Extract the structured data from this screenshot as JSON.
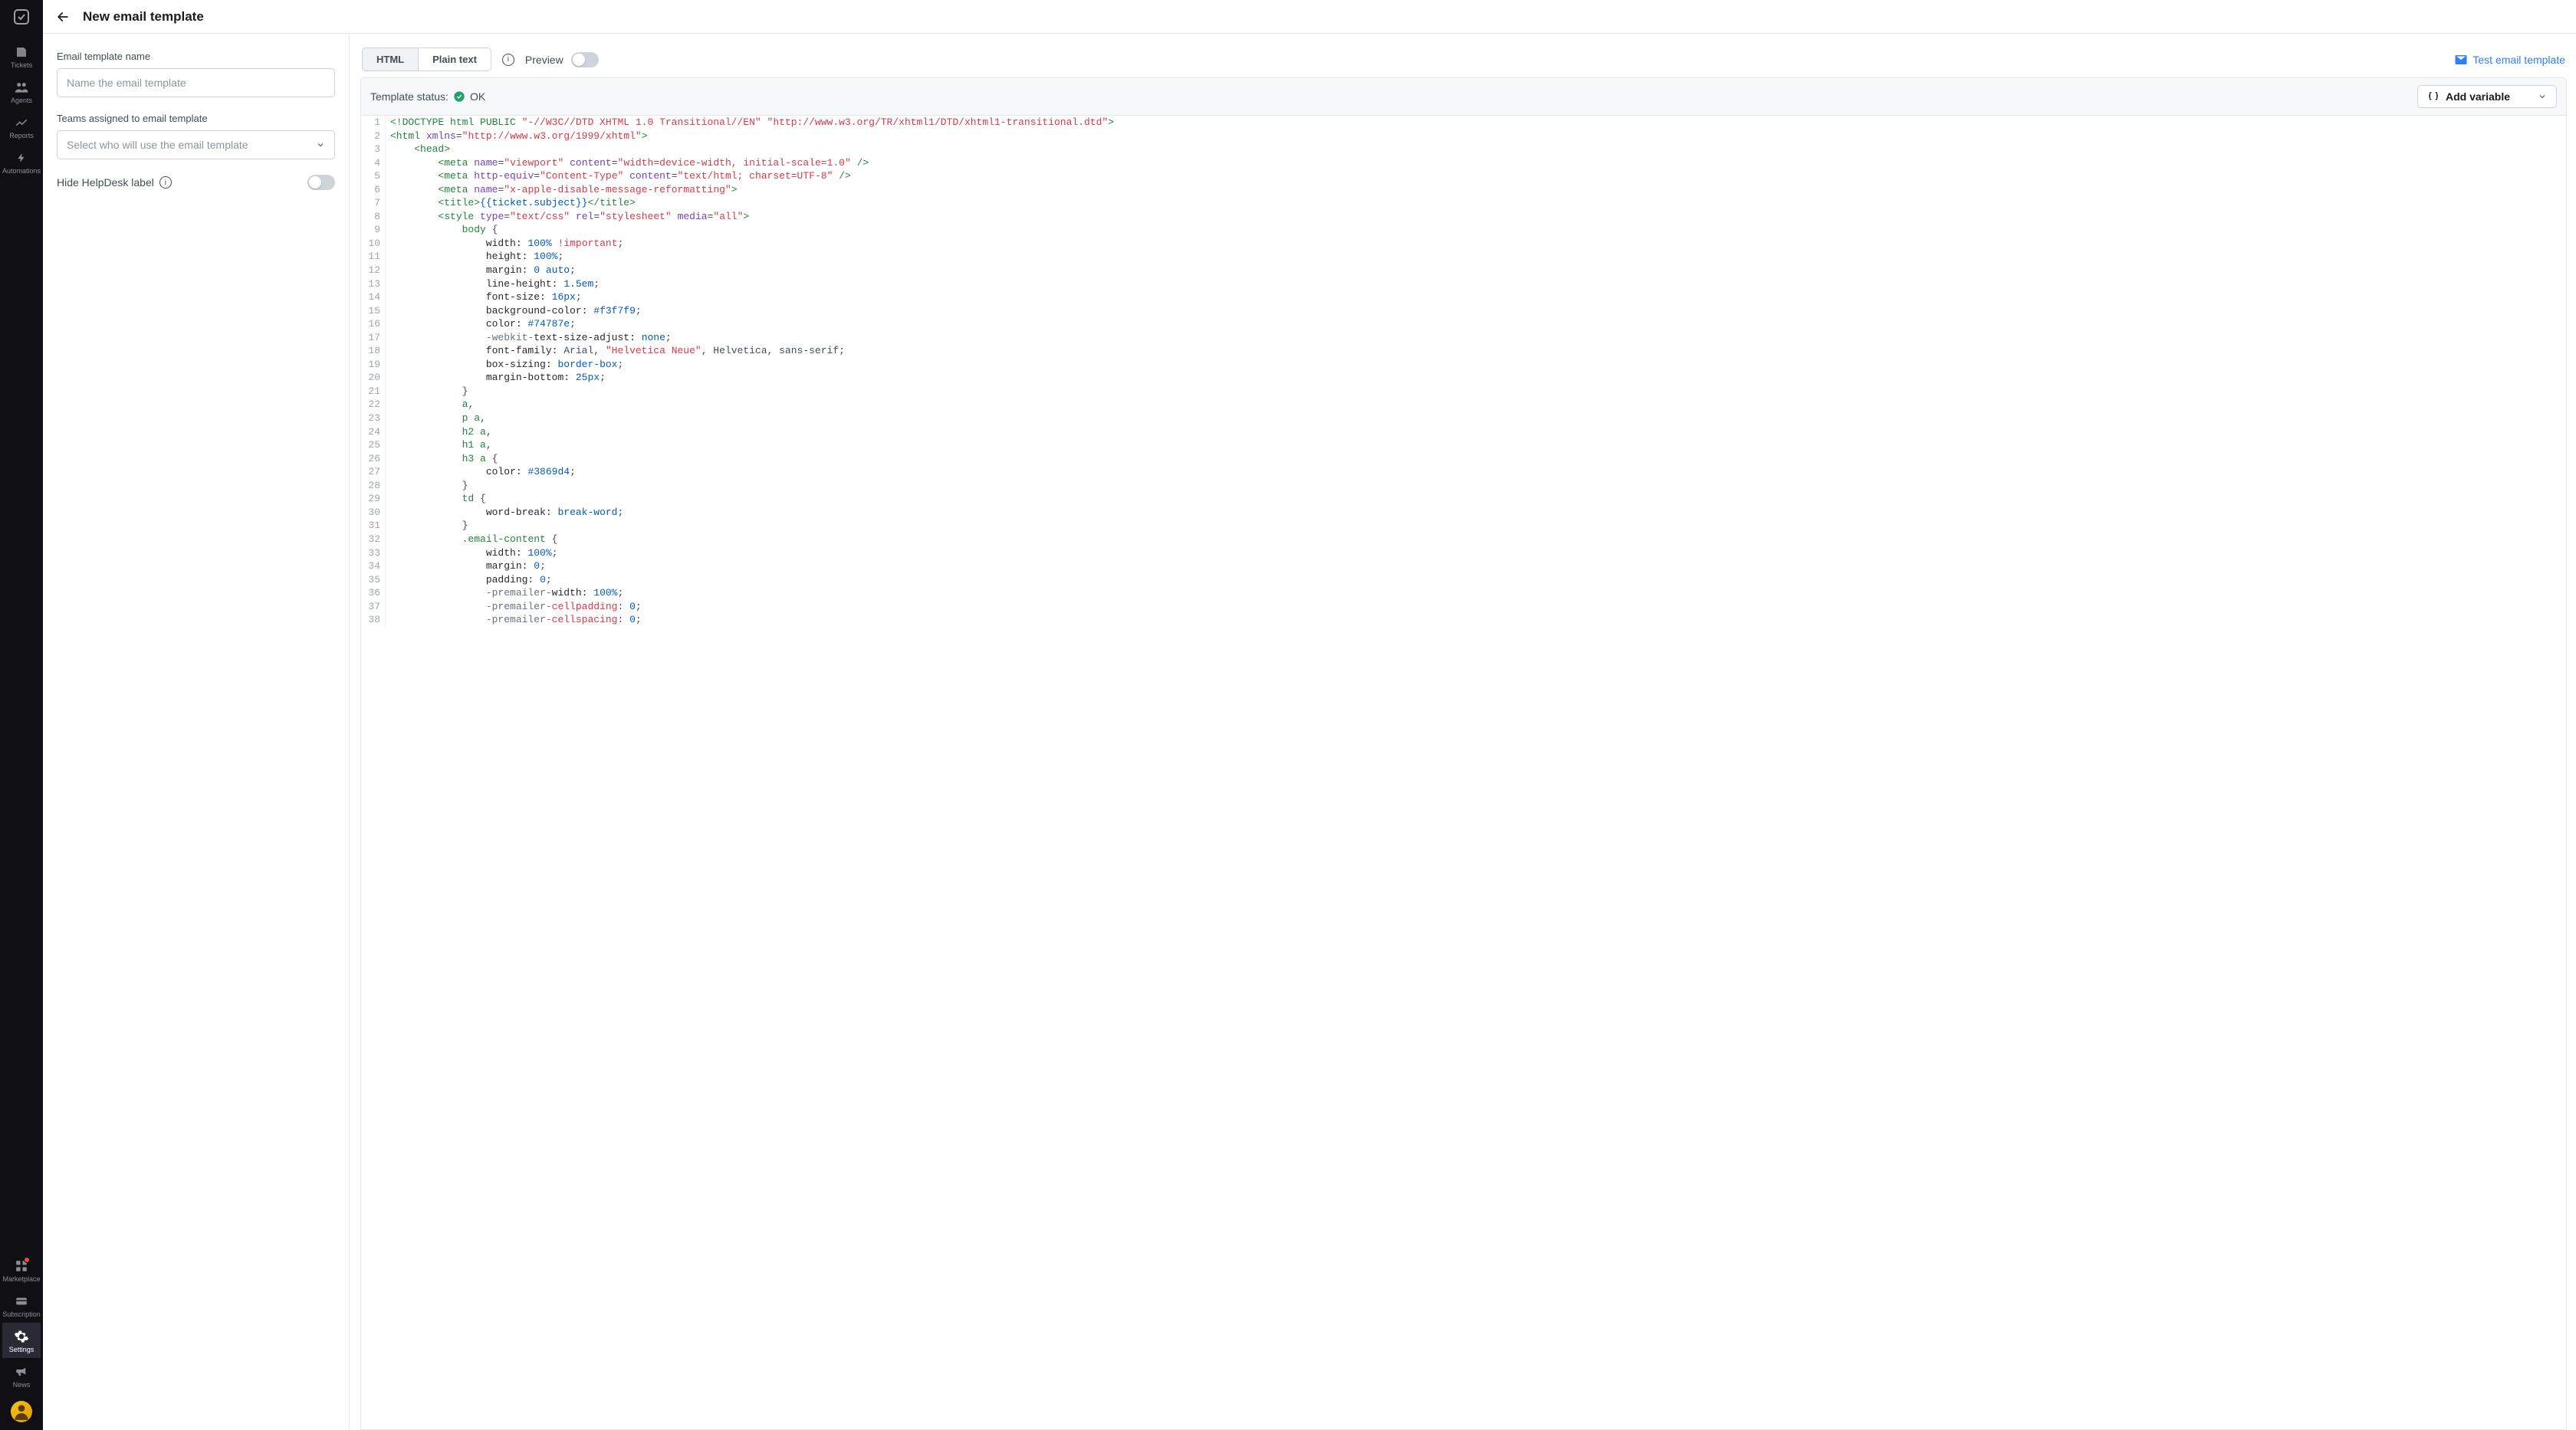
{
  "sidebar": {
    "items": [
      {
        "label": "Tickets",
        "icon": "ticket"
      },
      {
        "label": "Agents",
        "icon": "agents"
      },
      {
        "label": "Reports",
        "icon": "reports"
      },
      {
        "label": "Automations",
        "icon": "automations"
      }
    ],
    "bottom": [
      {
        "label": "Marketplace",
        "icon": "marketplace",
        "has_badge": true
      },
      {
        "label": "Subscription",
        "icon": "subscription"
      },
      {
        "label": "Settings",
        "icon": "settings",
        "active": true
      },
      {
        "label": "News",
        "icon": "news"
      }
    ]
  },
  "topbar": {
    "title": "New email template"
  },
  "left": {
    "name_label": "Email template name",
    "name_placeholder": "Name the email template",
    "teams_label": "Teams assigned to email template",
    "teams_placeholder": "Select who will use the email template",
    "hide_label": "Hide HelpDesk label"
  },
  "editor": {
    "tabs": {
      "html": "HTML",
      "plain": "Plain text"
    },
    "preview_label": "Preview",
    "test_link": "Test email template",
    "status_label": "Template status:",
    "status_value": "OK",
    "add_variable": "Add variable"
  },
  "code_lines": [
    {
      "n": 1,
      "t": "<span class='c-tag'>&lt;!DOCTYPE html PUBLIC </span><span class='c-str'>\"-//W3C//DTD XHTML 1.0 Transitional//EN\"</span> <span class='c-str'>\"http://www.w3.org/TR/xhtml1/DTD/xhtml1-transitional.dtd\"</span><span class='c-tag'>&gt;</span>"
    },
    {
      "n": 2,
      "t": "<span class='c-tag'>&lt;html</span> <span class='c-attr'>xmlns</span>=<span class='c-str'>\"http://www.w3.org/1999/xhtml\"</span><span class='c-tag'>&gt;</span>"
    },
    {
      "n": 3,
      "t": "    <span class='c-tag'>&lt;head&gt;</span>"
    },
    {
      "n": 4,
      "t": "        <span class='c-tag'>&lt;meta</span> <span class='c-attr'>name</span>=<span class='c-str'>\"viewport\"</span> <span class='c-attr'>content</span>=<span class='c-str'>\"width=device-width, initial-scale=1.0\"</span> <span class='c-tag'>/&gt;</span>"
    },
    {
      "n": 5,
      "t": "        <span class='c-tag'>&lt;meta</span> <span class='c-attr'>http-equiv</span>=<span class='c-str'>\"Content-Type\"</span> <span class='c-attr'>content</span>=<span class='c-str'>\"text/html; charset=UTF-8\"</span> <span class='c-tag'>/&gt;</span>"
    },
    {
      "n": 6,
      "t": "        <span class='c-tag'>&lt;meta</span> <span class='c-attr'>name</span>=<span class='c-str'>\"x-apple-disable-message-reformatting\"</span><span class='c-tag'>&gt;</span>"
    },
    {
      "n": 7,
      "t": "        <span class='c-tag'>&lt;title&gt;</span><span class='c-var'>{{ticket.subject}}</span><span class='c-tag'>&lt;/title&gt;</span>"
    },
    {
      "n": 8,
      "t": "        <span class='c-tag'>&lt;style</span> <span class='c-attr'>type</span>=<span class='c-str'>\"text/css\"</span> <span class='c-attr'>rel</span>=<span class='c-str'>\"stylesheet\"</span> <span class='c-attr'>media</span>=<span class='c-str'>\"all\"</span><span class='c-tag'>&gt;</span>"
    },
    {
      "n": 9,
      "t": "            <span class='c-sel'>body</span> {"
    },
    {
      "n": 10,
      "t": "                <span class='c-prop'>width:</span> <span class='c-val'>100%</span> <span class='c-imp'>!important</span>;"
    },
    {
      "n": 11,
      "t": "                <span class='c-prop'>height:</span> <span class='c-val'>100%</span>;"
    },
    {
      "n": 12,
      "t": "                <span class='c-prop'>margin:</span> <span class='c-val'>0</span> <span class='c-val'>auto</span>;"
    },
    {
      "n": 13,
      "t": "                <span class='c-prop'>line-height:</span> <span class='c-val'>1.5em</span>;"
    },
    {
      "n": 14,
      "t": "                <span class='c-prop'>font-size:</span> <span class='c-val'>16px</span>;"
    },
    {
      "n": 15,
      "t": "                <span class='c-prop'>background-color:</span> <span class='c-val'>#f3f7f9</span>;"
    },
    {
      "n": 16,
      "t": "                <span class='c-prop'>color:</span> <span class='c-val'>#74787e</span>;"
    },
    {
      "n": 17,
      "t": "                <span class='c-pfx'>-webkit-</span><span class='c-prop'>text-size-adjust:</span> <span class='c-val'>none</span>;"
    },
    {
      "n": 18,
      "t": "                <span class='c-prop'>font-family:</span> Arial, <span class='c-str'>\"Helvetica Neue\"</span>, Helvetica, sans-serif;"
    },
    {
      "n": 19,
      "t": "                <span class='c-prop'>box-sizing:</span> <span class='c-val'>border-box</span>;"
    },
    {
      "n": 20,
      "t": "                <span class='c-prop'>margin-bottom:</span> <span class='c-val'>25px</span>;"
    },
    {
      "n": 21,
      "t": "            }"
    },
    {
      "n": 22,
      "t": "            <span class='c-sel'>a</span>,"
    },
    {
      "n": 23,
      "t": "            <span class='c-sel'>p a</span>,"
    },
    {
      "n": 24,
      "t": "            <span class='c-sel'>h2 a</span>,"
    },
    {
      "n": 25,
      "t": "            <span class='c-sel'>h1 a</span>,"
    },
    {
      "n": 26,
      "t": "            <span class='c-sel'>h3 a</span> {"
    },
    {
      "n": 27,
      "t": "                <span class='c-prop'>color:</span> <span class='c-val'>#3869d4</span>;"
    },
    {
      "n": 28,
      "t": "            }"
    },
    {
      "n": 29,
      "t": "            <span class='c-sel'>td</span> {"
    },
    {
      "n": 30,
      "t": "                <span class='c-prop'>word-break:</span> <span class='c-val'>break-word</span>;"
    },
    {
      "n": 31,
      "t": "            }"
    },
    {
      "n": 32,
      "t": "            <span class='c-sel'>.email-content</span> {"
    },
    {
      "n": 33,
      "t": "                <span class='c-prop'>width:</span> <span class='c-val'>100%</span>;"
    },
    {
      "n": 34,
      "t": "                <span class='c-prop'>margin:</span> <span class='c-val'>0</span>;"
    },
    {
      "n": 35,
      "t": "                <span class='c-prop'>padding:</span> <span class='c-val'>0</span>;"
    },
    {
      "n": 36,
      "t": "                <span class='c-pfx'>-premailer-</span><span class='c-prop'>width:</span> <span class='c-val'>100%</span>;"
    },
    {
      "n": 37,
      "t": "                <span class='c-pfx'>-premailer-</span><span class='c-imp'>cellpadding</span>: <span class='c-val'>0</span>;"
    },
    {
      "n": 38,
      "t": "                <span class='c-pfx'>-premailer-</span><span class='c-imp'>cellspacing</span>: <span class='c-val'>0</span>;"
    }
  ]
}
